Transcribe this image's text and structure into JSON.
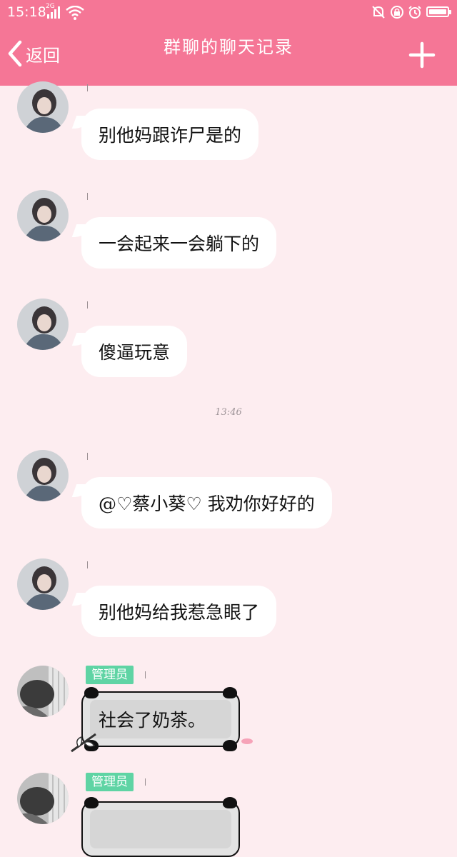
{
  "status_bar": {
    "time": "15:18",
    "network": "2G",
    "icons": [
      "signal-icon",
      "wifi-icon",
      "silent-bell-icon",
      "lock-rotation-icon",
      "alarm-icon",
      "battery-icon"
    ]
  },
  "header": {
    "back_label": "返回",
    "title": "群聊的聊天记录",
    "add_icon": "plus-icon"
  },
  "messages": [
    {
      "sender": "",
      "text": "别他妈跟诈尸是的"
    },
    {
      "sender": "",
      "text": "一会起来一会躺下的"
    },
    {
      "sender": "",
      "text": "傻逼玩意"
    },
    {
      "sender": "",
      "text": "@♡蔡小葵♡ 我劝你好好的"
    },
    {
      "sender": "",
      "text": "别他妈给我惹急眼了"
    },
    {
      "sender": "",
      "badge": "管理员",
      "text": "社会了奶茶。"
    },
    {
      "sender": "",
      "badge": "管理员",
      "text": ""
    }
  ],
  "timestamp": "13:46",
  "colors": {
    "header": "#f57696",
    "background": "#fdedf0",
    "badge": "#5fd4a4",
    "bubble": "#ffffff"
  }
}
